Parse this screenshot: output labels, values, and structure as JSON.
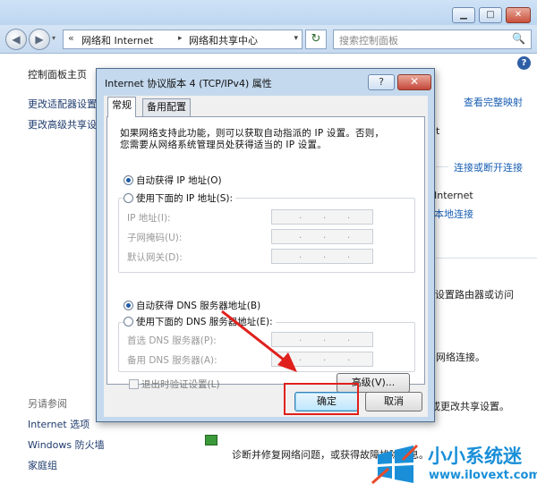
{
  "window": {
    "back_glyph": "◀",
    "forward_glyph": "▶",
    "minimize_glyph": "▁",
    "maximize_glyph": "□",
    "close_glyph": "✕",
    "nav_history_glyph": "▾",
    "address_icon_glyph": "«",
    "breadcrumb_sep": "▸",
    "address_dropdown_glyph": "▾",
    "refresh_glyph": "↻",
    "breadcrumbs": [
      "网络和 Internet",
      "网络和共享中心"
    ],
    "search_placeholder": "搜索控制面板",
    "search_icon_glyph": "🔍",
    "help_glyph": "?"
  },
  "left_pane": {
    "home": "控制面板主页",
    "adapter": "更改适配器设置",
    "advanced": "更改高级共享设",
    "see_also": "另请参阅",
    "internet_options": "Internet 选项",
    "firewall": "Windows 防火墙",
    "homegroup": "家庭组"
  },
  "right_fragments": {
    "full_map": "查看完整映射",
    "letter_t": "t",
    "connect_disconnect": "连接或断开连接",
    "internet": "Internet",
    "local_connection": "本地连接",
    "router_access": "设置路由器或访问",
    "network_connect": "网络连接。",
    "change_sharing": "或更改共享设置。",
    "diagnose": "诊断并修复网络问题，或获得故障排除信息。"
  },
  "watermark": {
    "name": "小小系统迷",
    "url": "www.ilovext.com"
  },
  "dialog": {
    "title": "Internet 协议版本 4 (TCP/IPv4) 属性",
    "help_glyph": "?",
    "close_glyph": "✕",
    "tabs": [
      "常规",
      "备用配置"
    ],
    "description_lines": [
      "如果网络支持此功能，则可以获取自动指派的 IP 设置。否则，",
      "您需要从网络系统管理员处获得适当的 IP 设置。"
    ],
    "ip_auto": "自动获得 IP 地址(O)",
    "ip_manual": "使用下面的 IP 地址(S):",
    "ip_fields": [
      "IP 地址(I):",
      "子网掩码(U):",
      "默认网关(D):"
    ],
    "dns_auto": "自动获得 DNS 服务器地址(B)",
    "dns_manual": "使用下面的 DNS 服务器地址(E):",
    "dns_fields": [
      "首选 DNS 服务器(P):",
      "备用 DNS 服务器(A):"
    ],
    "ip_dot": ".",
    "validate_on_exit": "退出时验证设置(L)",
    "advanced_button": "高级(V)...",
    "ok_button": "确定",
    "cancel_button": "取消"
  }
}
